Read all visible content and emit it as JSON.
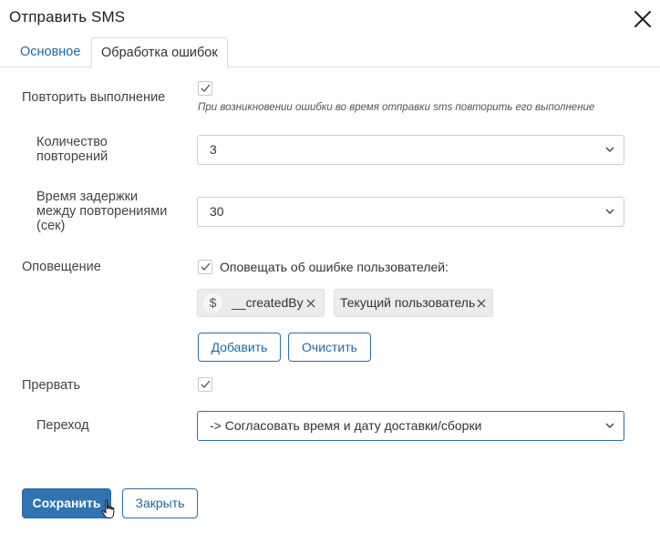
{
  "dialog": {
    "title": "Отправить SMS"
  },
  "tabs": [
    {
      "label": "Основное",
      "active": false
    },
    {
      "label": "Обработка ошибок",
      "active": true
    }
  ],
  "form": {
    "retry": {
      "label": "Повторить выполнение",
      "checked": true,
      "hint": "При возникновении ошибки во время отправки sms повторить его выполнение"
    },
    "retry_count": {
      "label_line1": "Количество",
      "label_line2": "повторений",
      "value": "3"
    },
    "retry_delay": {
      "label_line1": "Время задержки",
      "label_line2": "между повторениями",
      "label_line3": "(сек)",
      "value": "30"
    },
    "notify": {
      "label": "Оповещение",
      "checkbox_label": "Оповещать об ошибке пользователей:",
      "checked": true,
      "tags": [
        {
          "label": "__createdBy",
          "icon": "dollar-icon"
        },
        {
          "label": "Текущий пользователь"
        }
      ],
      "add_label": "Добавить",
      "clear_label": "Очистить"
    },
    "interrupt": {
      "label": "Прервать",
      "checked": true
    },
    "transition": {
      "label": "Переход",
      "value": "-> Согласовать время и дату доставки/сборки"
    }
  },
  "footer": {
    "save_label": "Сохранить",
    "close_label": "Закрыть"
  },
  "colors": {
    "accent": "#2f74b0",
    "link": "#1f6aa6",
    "border": "#cfcfcf"
  }
}
